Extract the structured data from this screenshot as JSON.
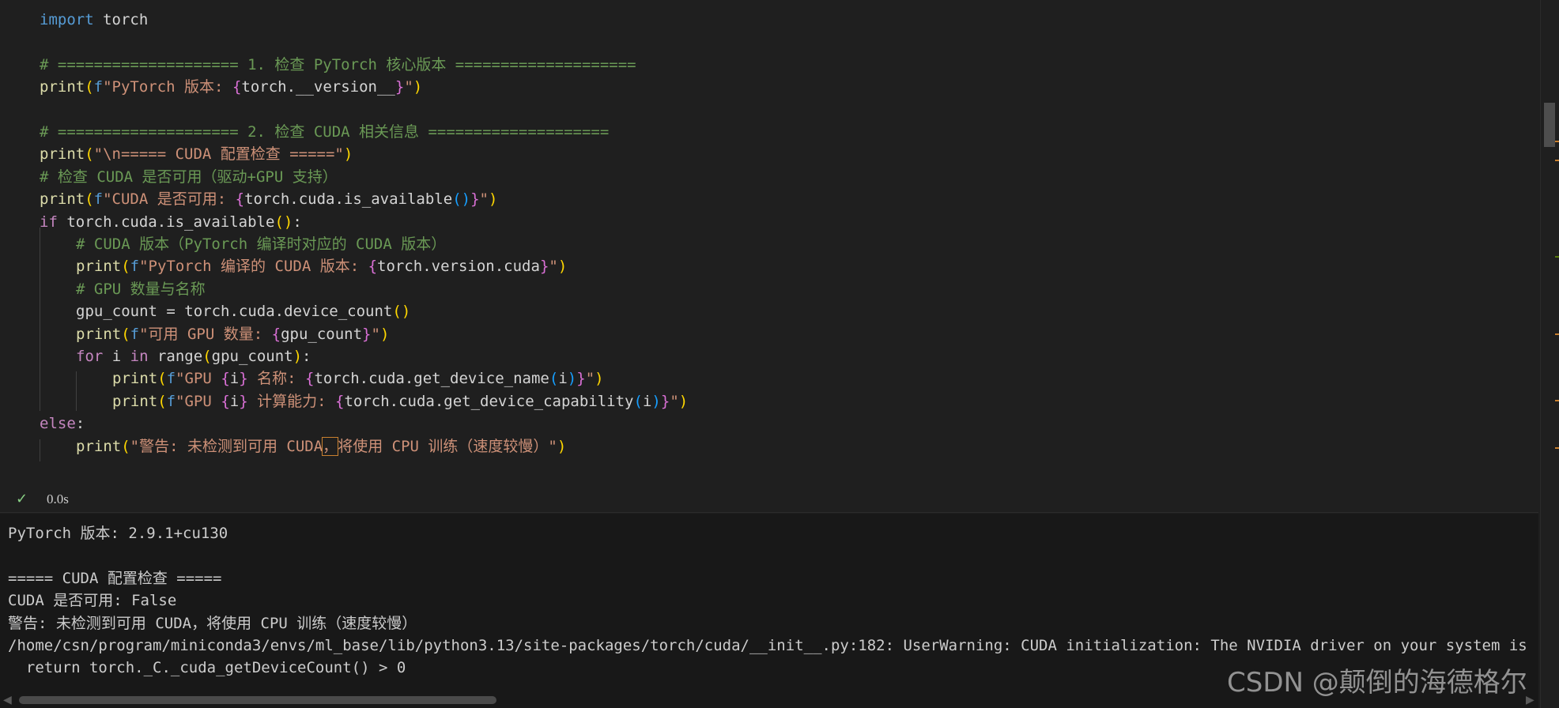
{
  "code_cell": {
    "lines": [
      {
        "indent": 0,
        "tokens": [
          [
            "kw",
            "import"
          ],
          [
            "txt",
            " torch"
          ]
        ]
      },
      {
        "indent": 0,
        "tokens": []
      },
      {
        "indent": 0,
        "tokens": [
          [
            "cm",
            "# ==================== 1. 检查 PyTorch 核心版本 ===================="
          ]
        ]
      },
      {
        "indent": 0,
        "tokens": [
          [
            "fn",
            "print"
          ],
          [
            "par",
            "("
          ],
          [
            "kw",
            "f"
          ],
          [
            "str",
            "\"PyTorch 版本: "
          ],
          [
            "par2",
            "{"
          ],
          [
            "txt",
            "torch.__version__"
          ],
          [
            "par2",
            "}"
          ],
          [
            "str",
            "\""
          ],
          [
            "par",
            ")"
          ]
        ]
      },
      {
        "indent": 0,
        "tokens": []
      },
      {
        "indent": 0,
        "tokens": [
          [
            "cm",
            "# ==================== 2. 检查 CUDA 相关信息 ===================="
          ]
        ]
      },
      {
        "indent": 0,
        "tokens": [
          [
            "fn",
            "print"
          ],
          [
            "par",
            "("
          ],
          [
            "str",
            "\"\\n===== CUDA 配置检查 =====\""
          ],
          [
            "par",
            ")"
          ]
        ]
      },
      {
        "indent": 0,
        "tokens": [
          [
            "cm",
            "# 检查 CUDA 是否可用（驱动+GPU 支持）"
          ]
        ]
      },
      {
        "indent": 0,
        "tokens": [
          [
            "fn",
            "print"
          ],
          [
            "par",
            "("
          ],
          [
            "kw",
            "f"
          ],
          [
            "str",
            "\"CUDA 是否可用: "
          ],
          [
            "par2",
            "{"
          ],
          [
            "txt",
            "torch.cuda.is_available"
          ],
          [
            "par3",
            "()"
          ],
          [
            "par2",
            "}"
          ],
          [
            "str",
            "\""
          ],
          [
            "par",
            ")"
          ]
        ]
      },
      {
        "indent": 0,
        "tokens": [
          [
            "kw2",
            "if"
          ],
          [
            "txt",
            " torch.cuda.is_available"
          ],
          [
            "par",
            "()"
          ],
          [
            "txt",
            ":"
          ]
        ]
      },
      {
        "indent": 1,
        "tokens": [
          [
            "cm",
            "# CUDA 版本（PyTorch 编译时对应的 CUDA 版本）"
          ]
        ]
      },
      {
        "indent": 1,
        "tokens": [
          [
            "fn",
            "print"
          ],
          [
            "par",
            "("
          ],
          [
            "kw",
            "f"
          ],
          [
            "str",
            "\"PyTorch 编译的 CUDA 版本: "
          ],
          [
            "par2",
            "{"
          ],
          [
            "txt",
            "torch.version.cuda"
          ],
          [
            "par2",
            "}"
          ],
          [
            "str",
            "\""
          ],
          [
            "par",
            ")"
          ]
        ]
      },
      {
        "indent": 1,
        "tokens": [
          [
            "cm",
            "# GPU 数量与名称"
          ]
        ]
      },
      {
        "indent": 1,
        "tokens": [
          [
            "txt",
            "gpu_count = torch.cuda.device_count"
          ],
          [
            "par",
            "()"
          ]
        ]
      },
      {
        "indent": 1,
        "tokens": [
          [
            "fn",
            "print"
          ],
          [
            "par",
            "("
          ],
          [
            "kw",
            "f"
          ],
          [
            "str",
            "\"可用 GPU 数量: "
          ],
          [
            "par2",
            "{"
          ],
          [
            "txt",
            "gpu_count"
          ],
          [
            "par2",
            "}"
          ],
          [
            "str",
            "\""
          ],
          [
            "par",
            ")"
          ]
        ]
      },
      {
        "indent": 1,
        "tokens": [
          [
            "kw2",
            "for"
          ],
          [
            "txt",
            " i "
          ],
          [
            "kw2",
            "in"
          ],
          [
            "txt",
            " range"
          ],
          [
            "par",
            "("
          ],
          [
            "txt",
            "gpu_count"
          ],
          [
            "par",
            ")"
          ],
          [
            "txt",
            ":"
          ]
        ]
      },
      {
        "indent": 2,
        "tokens": [
          [
            "fn",
            "print"
          ],
          [
            "par",
            "("
          ],
          [
            "kw",
            "f"
          ],
          [
            "str",
            "\"GPU "
          ],
          [
            "par2",
            "{"
          ],
          [
            "txt",
            "i"
          ],
          [
            "par2",
            "}"
          ],
          [
            "str",
            " 名称: "
          ],
          [
            "par2",
            "{"
          ],
          [
            "txt",
            "torch.cuda.get_device_name"
          ],
          [
            "par3",
            "("
          ],
          [
            "txt",
            "i"
          ],
          [
            "par3",
            ")"
          ],
          [
            "par2",
            "}"
          ],
          [
            "str",
            "\""
          ],
          [
            "par",
            ")"
          ]
        ]
      },
      {
        "indent": 2,
        "tokens": [
          [
            "fn",
            "print"
          ],
          [
            "par",
            "("
          ],
          [
            "kw",
            "f"
          ],
          [
            "str",
            "\"GPU "
          ],
          [
            "par2",
            "{"
          ],
          [
            "txt",
            "i"
          ],
          [
            "par2",
            "}"
          ],
          [
            "str",
            " 计算能力: "
          ],
          [
            "par2",
            "{"
          ],
          [
            "txt",
            "torch.cuda.get_device_capability"
          ],
          [
            "par3",
            "("
          ],
          [
            "txt",
            "i"
          ],
          [
            "par3",
            ")"
          ],
          [
            "par2",
            "}"
          ],
          [
            "str",
            "\""
          ],
          [
            "par",
            ")"
          ]
        ]
      },
      {
        "indent": 0,
        "tokens": [
          [
            "kw2",
            "else"
          ],
          [
            "txt",
            ":"
          ]
        ]
      },
      {
        "indent": 1,
        "tokens": [
          [
            "fn",
            "print"
          ],
          [
            "par",
            "("
          ],
          [
            "str",
            "\"警告: 未检测到可用 CUDA"
          ],
          [
            "strbox",
            "，"
          ],
          [
            "str",
            "将使用 CPU 训练（速度较慢）\""
          ],
          [
            "par",
            ")"
          ]
        ]
      }
    ]
  },
  "status": {
    "check_icon": "check-icon",
    "duration": "0.0s"
  },
  "output": {
    "lines": [
      "PyTorch 版本: 2.9.1+cu130",
      "",
      "===== CUDA 配置检查 =====",
      "CUDA 是否可用: False",
      "警告: 未检测到可用 CUDA，将使用 CPU 训练（速度较慢）",
      "/home/csn/program/miniconda3/envs/ml_base/lib/python3.13/site-packages/torch/cuda/__init__.py:182: UserWarning: CUDA initialization: The NVIDIA driver on your system is",
      "  return torch._C._cuda_getDeviceCount() > 0"
    ]
  },
  "watermark": "CSDN @颠倒的海德格尔",
  "colors": {
    "background": "#1f1f1f",
    "output_background": "#181818",
    "keyword": "#569cd6",
    "control_keyword": "#c586c0",
    "comment": "#6a9955",
    "string": "#ce9178",
    "function": "#dcdcaa",
    "bracket1": "#ffd700",
    "bracket2": "#da70d6",
    "bracket3": "#179fff"
  }
}
